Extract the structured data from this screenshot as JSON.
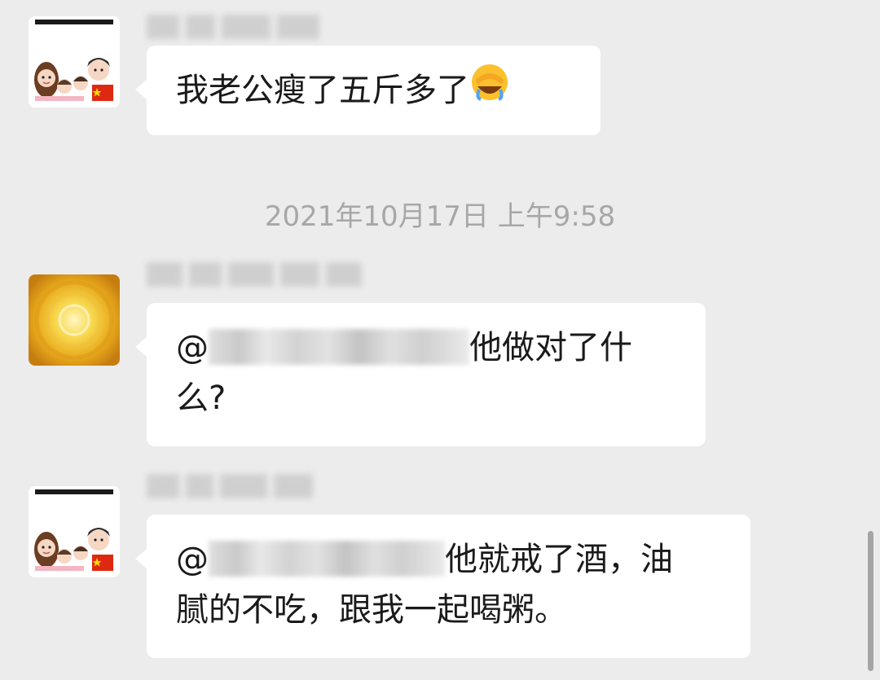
{
  "messages": [
    {
      "text": "我老公瘦了五斤多了",
      "emoji": "face-with-hand-over-eyes-laughing-emoji"
    },
    {
      "prefix": "@",
      "text_line1": "他做对了什",
      "text_line2": "么?"
    },
    {
      "prefix": "@",
      "text_line1": "他就戒了酒，油",
      "text_line2": "腻的不吃，跟我一起喝粥。"
    }
  ],
  "timestamp": "2021年10月17日 上午9:58",
  "colors": {
    "background": "#ececec",
    "bubble": "#ffffff",
    "timestamp_text": "#a7a7a7"
  }
}
